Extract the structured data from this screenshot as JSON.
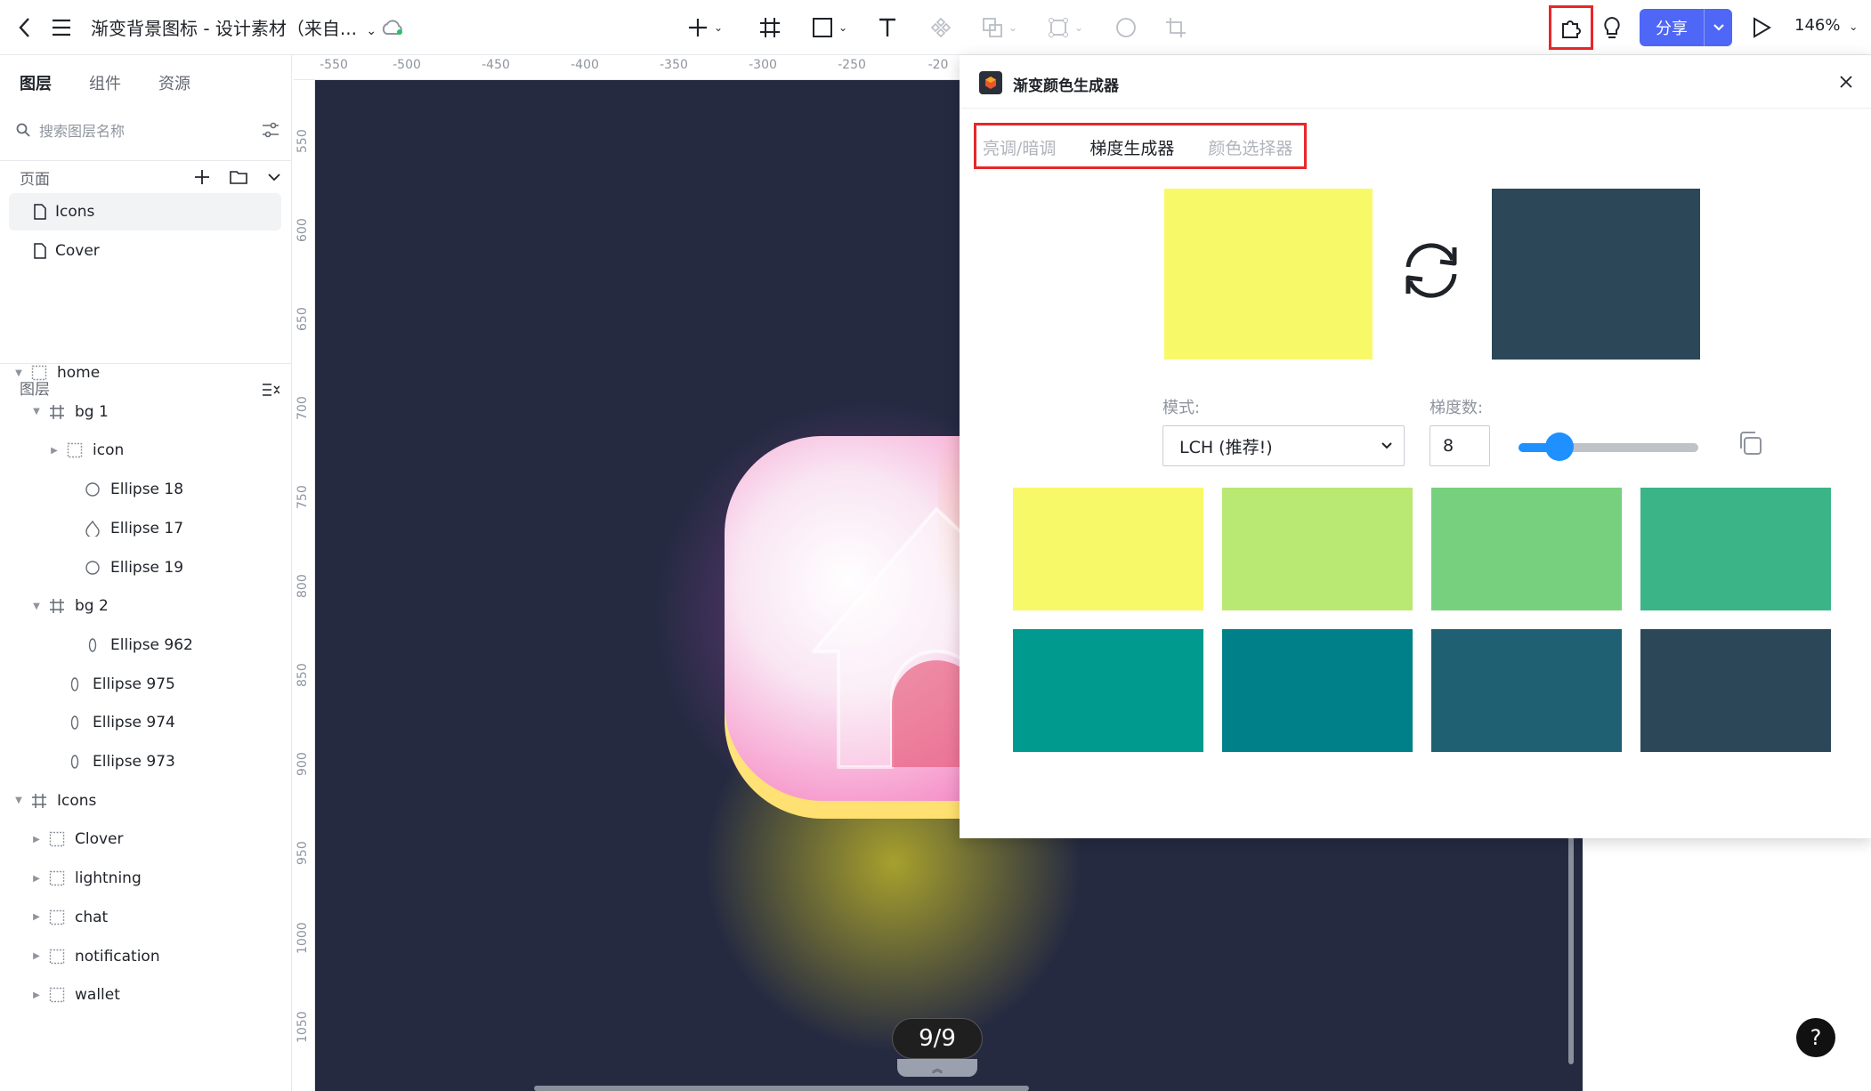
{
  "toolbar": {
    "title": "渐变背景图标 - 设计素材（来自...",
    "share_label": "分享",
    "zoom": "146%"
  },
  "left_panel": {
    "tabs": [
      "图层",
      "组件",
      "资源"
    ],
    "search_placeholder": "搜索图层名称",
    "pages_title": "页面",
    "pages": [
      "Icons",
      "Cover"
    ],
    "layers_title": "图层",
    "layers": [
      {
        "label": "home",
        "icon": "component-icon",
        "arrow": "down"
      },
      {
        "label": "bg 1",
        "icon": "frame-icon",
        "arrow": "down"
      },
      {
        "label": "icon",
        "icon": "component-icon",
        "arrow": "right"
      },
      {
        "label": "Ellipse 18",
        "icon": "ellipse-icon",
        "arrow": ""
      },
      {
        "label": "Ellipse 17",
        "icon": "drop-icon",
        "arrow": ""
      },
      {
        "label": "Ellipse 19",
        "icon": "ellipse-icon",
        "arrow": ""
      },
      {
        "label": "bg 2",
        "icon": "frame-icon",
        "arrow": "down"
      },
      {
        "label": "Ellipse 962",
        "icon": "oval-icon",
        "arrow": ""
      },
      {
        "label": "Ellipse 975",
        "icon": "oval-icon",
        "arrow": ""
      },
      {
        "label": "Ellipse 974",
        "icon": "oval-icon",
        "arrow": ""
      },
      {
        "label": "Ellipse 973",
        "icon": "oval-icon",
        "arrow": ""
      },
      {
        "label": "Icons",
        "icon": "frame-icon",
        "arrow": "down"
      },
      {
        "label": "Clover",
        "icon": "component-icon",
        "arrow": "right"
      },
      {
        "label": "lightning",
        "icon": "component-icon",
        "arrow": "right"
      },
      {
        "label": "chat",
        "icon": "component-icon",
        "arrow": "right"
      },
      {
        "label": "notification",
        "icon": "component-icon",
        "arrow": "right"
      },
      {
        "label": "wallet",
        "icon": "component-icon",
        "arrow": "right"
      }
    ]
  },
  "ruler": {
    "top": [
      "-550",
      "-500",
      "-450",
      "-400",
      "-350",
      "-300",
      "-250",
      "-20"
    ],
    "left": [
      "550",
      "600",
      "650",
      "700",
      "750",
      "800",
      "850",
      "900",
      "950",
      "1000",
      "1050"
    ]
  },
  "canvas": {
    "counter": "9/9",
    "counter_tab": "︽"
  },
  "plugin": {
    "title": "渐变颜色生成器",
    "tabs": [
      "亮调/暗调",
      "梯度生成器",
      "颜色选择器"
    ],
    "start_color": "#F8F969",
    "end_color": "#2B4758",
    "mode_label": "模式:",
    "mode_value": "LCH (推荐!)",
    "steps_label": "梯度数:",
    "steps_value": "8",
    "gradient": [
      "#F8F969",
      "#B9E873",
      "#76D07E",
      "#3BB487",
      "#009A8F",
      "#00818A",
      "#1F6072",
      "#2B4758"
    ]
  },
  "help_label": "?"
}
